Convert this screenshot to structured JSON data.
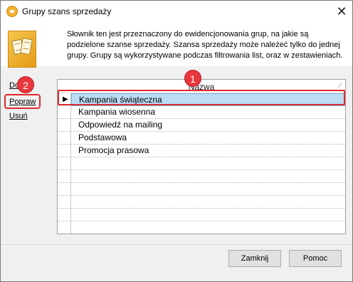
{
  "window": {
    "title": "Grupy szans sprzedaży",
    "icon": "app-icon",
    "close_glyph": "✕"
  },
  "header": {
    "icon": "books-icon",
    "description": "Słownik ten jest przeznaczony do ewidencjonowania grup, na jakie są podzielone szanse sprzedaży. Szansa sprzedaży może należeć tylko do jednej grupy. Grupy są wykorzystywane podczas filtrowania list, oraz w zestawieniach."
  },
  "sidebar": {
    "add_label": "Dodaj",
    "edit_label": "Popraw",
    "delete_label": "Usuń"
  },
  "grid": {
    "column_header": "Nazwa",
    "sort_glyph": "⁄",
    "row_indicator_glyph": "▶",
    "selected_index": 0,
    "rows": [
      "Kampania świąteczna",
      "Kampania wiosenna",
      "Odpowiedź na mailing",
      "Podstawowa",
      "Promocja prasowa",
      "",
      "",
      "",
      "",
      "",
      ""
    ]
  },
  "annotations": {
    "badge_1": "1",
    "badge_2": "2",
    "highlight_color": "#e0282e"
  },
  "buttons": {
    "close_label": "Zamknij",
    "help_label": "Pomoc"
  }
}
